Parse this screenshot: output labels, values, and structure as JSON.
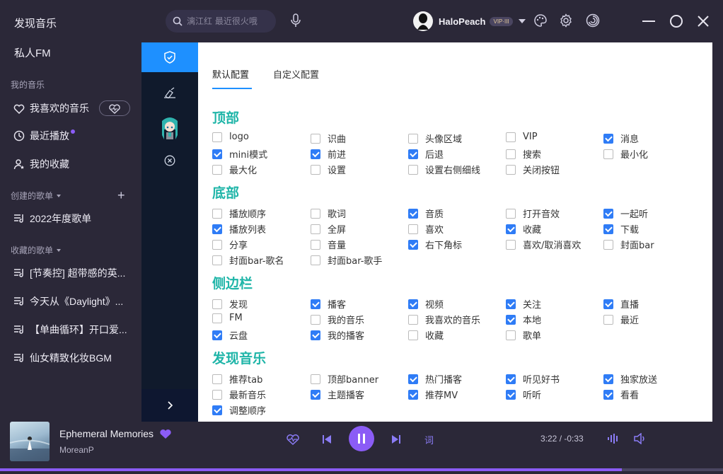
{
  "search": {
    "placeholder": "漓江红 最近很火哦"
  },
  "user": {
    "name": "HaloPeach",
    "badge": "VIP·III"
  },
  "sidebar": {
    "discover": "发现音乐",
    "fm": "私人FM",
    "my_music_title": "我的音乐",
    "liked": "我喜欢的音乐",
    "recent": "最近播放",
    "collection": "我的收藏",
    "created_title": "创建的歌单",
    "created": [
      "2022年度歌单"
    ],
    "collected_title": "收藏的歌单",
    "collected": [
      "[节奏控] 超带感的英...",
      "今天从《Daylight》...",
      "【单曲循环】开口爱...",
      "仙女精致化妆BGM"
    ]
  },
  "tabs": [
    "默认配置",
    "自定义配置"
  ],
  "sections": [
    {
      "title": "顶部",
      "options": [
        {
          "label": "logo",
          "checked": false
        },
        {
          "label": "识曲",
          "checked": false
        },
        {
          "label": "头像区域",
          "checked": false
        },
        {
          "label": "VIP",
          "checked": false
        },
        {
          "label": "消息",
          "checked": true
        },
        {
          "label": "mini模式",
          "checked": true
        },
        {
          "label": "前进",
          "checked": true
        },
        {
          "label": "后退",
          "checked": true
        },
        {
          "label": "搜索",
          "checked": false
        },
        {
          "label": "最小化",
          "checked": false
        },
        {
          "label": "最大化",
          "checked": false
        },
        {
          "label": "设置",
          "checked": false
        },
        {
          "label": "设置右侧细线",
          "checked": false
        },
        {
          "label": "关闭按钮",
          "checked": false
        }
      ]
    },
    {
      "title": "底部",
      "options": [
        {
          "label": "播放顺序",
          "checked": false
        },
        {
          "label": "歌词",
          "checked": false
        },
        {
          "label": "音质",
          "checked": true
        },
        {
          "label": "打开音效",
          "checked": false
        },
        {
          "label": "一起听",
          "checked": true
        },
        {
          "label": "播放列表",
          "checked": true
        },
        {
          "label": "全屏",
          "checked": false
        },
        {
          "label": "喜欢",
          "checked": false
        },
        {
          "label": "收藏",
          "checked": true
        },
        {
          "label": "下载",
          "checked": true
        },
        {
          "label": "分享",
          "checked": false
        },
        {
          "label": "音量",
          "checked": false
        },
        {
          "label": "右下角标",
          "checked": true
        },
        {
          "label": "喜欢/取消喜欢",
          "checked": false
        },
        {
          "label": "封面bar",
          "checked": false
        },
        {
          "label": "封面bar-歌名",
          "checked": false
        },
        {
          "label": "封面bar-歌手",
          "checked": false
        }
      ]
    },
    {
      "title": "侧边栏",
      "options": [
        {
          "label": "发现",
          "checked": false
        },
        {
          "label": "播客",
          "checked": true
        },
        {
          "label": "视频",
          "checked": true
        },
        {
          "label": "关注",
          "checked": true
        },
        {
          "label": "直播",
          "checked": true
        },
        {
          "label": "FM",
          "checked": false
        },
        {
          "label": "我的音乐",
          "checked": false
        },
        {
          "label": "我喜欢的音乐",
          "checked": false
        },
        {
          "label": "本地",
          "checked": true
        },
        {
          "label": "最近",
          "checked": false
        },
        {
          "label": "云盘",
          "checked": true
        },
        {
          "label": "我的播客",
          "checked": true
        },
        {
          "label": "收藏",
          "checked": false
        },
        {
          "label": "歌单",
          "checked": false
        }
      ]
    },
    {
      "title": "发现音乐",
      "options": [
        {
          "label": "推荐tab",
          "checked": false
        },
        {
          "label": "顶部banner",
          "checked": false
        },
        {
          "label": "热门播客",
          "checked": true
        },
        {
          "label": "听见好书",
          "checked": true
        },
        {
          "label": "独家放送",
          "checked": true
        },
        {
          "label": "最新音乐",
          "checked": false
        },
        {
          "label": "主题播客",
          "checked": true
        },
        {
          "label": "推荐MV",
          "checked": true
        },
        {
          "label": "听听",
          "checked": true
        },
        {
          "label": "看看",
          "checked": true
        },
        {
          "label": "调整顺序",
          "checked": true
        }
      ]
    }
  ],
  "player": {
    "title": "Ephemeral Memories",
    "artist": "MoreanP",
    "lyric_btn": "词",
    "time": "3:22 / -0:33",
    "progress": 0.86
  },
  "colors": {
    "accent": "#8b5cf6",
    "section": "#1fb5a8",
    "rail_active": "#1e90ff",
    "check": "#2f7cf6"
  }
}
